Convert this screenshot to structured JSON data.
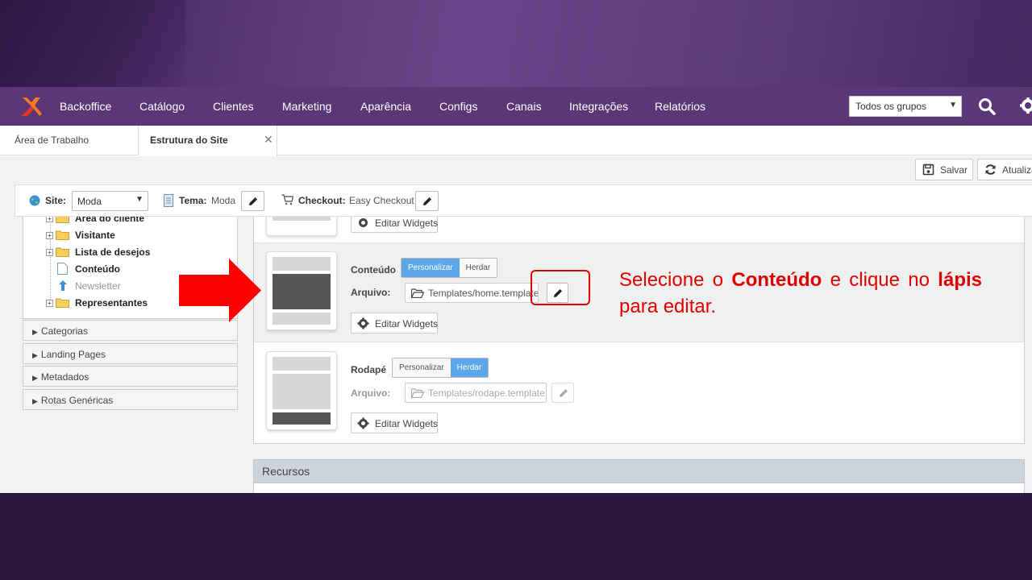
{
  "nav": {
    "items": [
      "Backoffice",
      "Catálogo",
      "Clientes",
      "Marketing",
      "Aparência",
      "Configs",
      "Canais",
      "Integrações",
      "Relatórios"
    ],
    "group_select": "Todos os grupos"
  },
  "tabs": {
    "area": "Área de Trabalho",
    "estrutura": "Estrutura do Site"
  },
  "toolbar": {
    "save": "Salvar",
    "refresh": "Atualiza"
  },
  "sitebar": {
    "site_label": "Site:",
    "site_value": "Moda",
    "tema_label": "Tema:",
    "tema_value": "Moda",
    "checkout_label": "Checkout:",
    "checkout_value": "Easy Checkout"
  },
  "tree": {
    "items": [
      "Área do cliente",
      "Visitante",
      "Lista de desejos",
      "Conteúdo",
      "Newsletter",
      "Representantes"
    ]
  },
  "accordions": [
    "Categorias",
    "Landing Pages",
    "Metadados",
    "Rotas Genéricas"
  ],
  "main": {
    "top_edit": "Editar Widgets",
    "conteudo": {
      "title": "Conteúdo",
      "customize": "Personalizar",
      "inherit": "Herdar",
      "file_label": "Arquivo:",
      "file": "Templates/home.template",
      "edit_widgets": "Editar Widgets"
    },
    "rodape": {
      "title": "Rodapé",
      "customize": "Personalizar",
      "inherit": "Herdar",
      "file_label": "Arquivo:",
      "file": "Templates/rodape.template",
      "edit_widgets": "Editar Widgets"
    },
    "recursos": "Recursos"
  },
  "callout": {
    "p1": "Selecione o ",
    "b1": "Conteúdo",
    "p2": " e clique no ",
    "b2": "lápis",
    "p3": " para editar."
  },
  "colors": {
    "nav": "#5b3777",
    "accent_blue": "#5ba6e8",
    "annotation_red": "#e00000"
  }
}
